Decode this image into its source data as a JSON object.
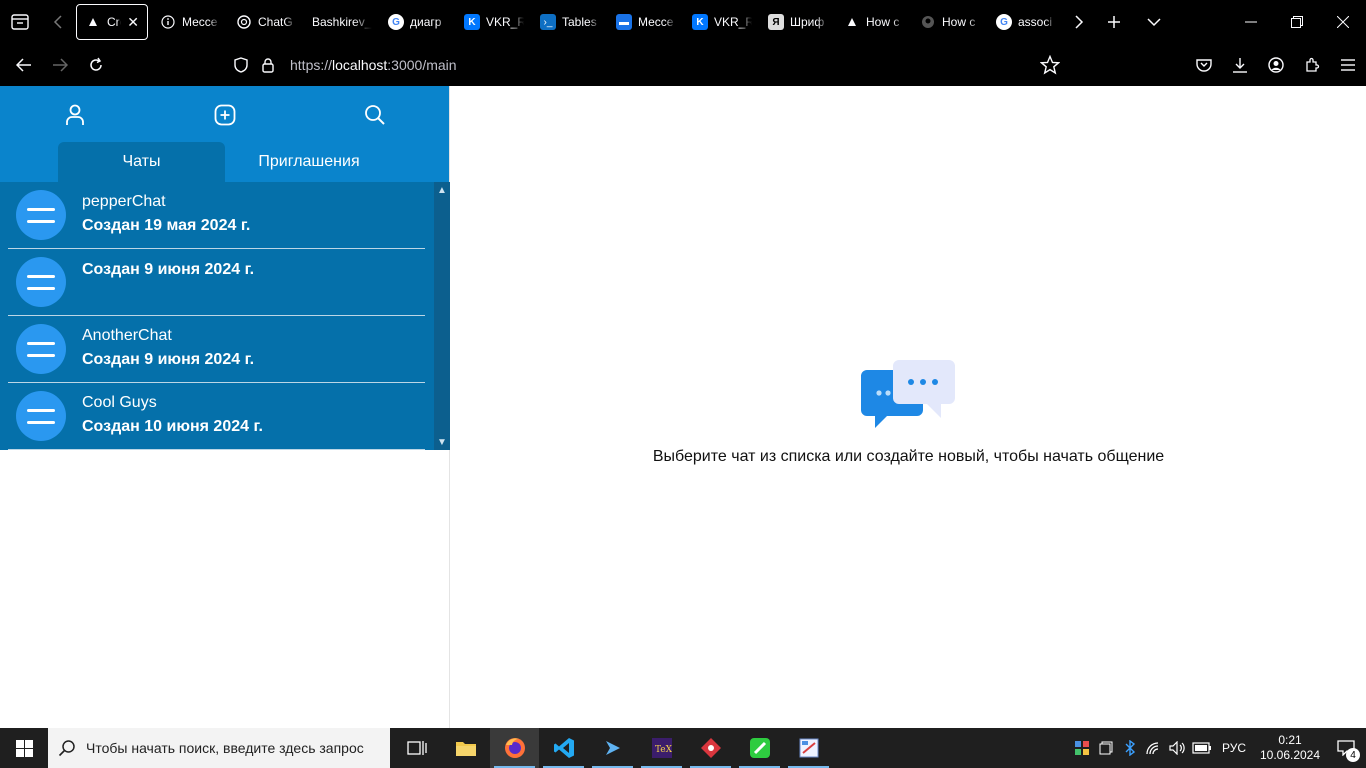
{
  "browser": {
    "tabs": [
      {
        "title": "Cre",
        "favicon": "triangle-icon",
        "active": true
      },
      {
        "title": "Мессе",
        "favicon": "info-icon",
        "active": false
      },
      {
        "title": "ChatG",
        "favicon": "openai-icon",
        "active": false
      },
      {
        "title": "Bashkirev_",
        "favicon": "",
        "active": false
      },
      {
        "title": "диагр",
        "favicon": "google-icon",
        "active": false
      },
      {
        "title": "VKR_R",
        "favicon": "vk-icon",
        "active": false
      },
      {
        "title": "Tables",
        "favicon": "terminal-icon",
        "active": false
      },
      {
        "title": "Мессе",
        "favicon": "chat-icon",
        "active": false
      },
      {
        "title": "VKR_R",
        "favicon": "vk-icon",
        "active": false
      },
      {
        "title": "Шриф",
        "favicon": "font-icon",
        "active": false
      },
      {
        "title": "How c",
        "favicon": "triangle-icon",
        "active": false
      },
      {
        "title": "How c",
        "favicon": "github-icon",
        "active": false
      },
      {
        "title": "associ",
        "favicon": "google-icon",
        "active": false
      }
    ],
    "active_tab_close": "✕",
    "url": {
      "prefix": "https://",
      "host": "localhost",
      "rest": ":3000/main"
    }
  },
  "sidebar": {
    "tabs": {
      "chats": "Чаты",
      "invites": "Приглашения"
    },
    "chats": [
      {
        "name": "pepperChat",
        "date": "Создан 19 мая 2024 г."
      },
      {
        "name": "",
        "date": "Создан 9 июня 2024 г."
      },
      {
        "name": "AnotherChat",
        "date": "Создан 9 июня 2024 г."
      },
      {
        "name": "Cool Guys",
        "date": "Создан 10 июня 2024 г."
      }
    ]
  },
  "main": {
    "empty_text": "Выберите чат из списка или создайте новый, чтобы начать общение"
  },
  "taskbar": {
    "search_placeholder": "Чтобы начать поиск, введите здесь запрос",
    "language": "РУС",
    "time": "0:21",
    "date": "10.06.2024",
    "notifications": "4"
  },
  "colors": {
    "sidebar_header": "#0a84cc",
    "chat_list": "#0570aa",
    "avatar": "#2a98f0"
  }
}
